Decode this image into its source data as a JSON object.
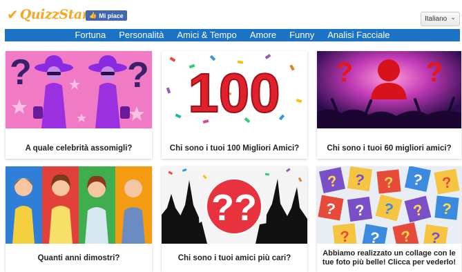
{
  "header": {
    "logo_text": "QuizzStar",
    "like_label": "Mi piace",
    "language": "Italiano"
  },
  "nav": {
    "items": [
      "Fortuna",
      "Personalità",
      "Amici & Tempo",
      "Amore",
      "Funny",
      "Analisi Facciale"
    ]
  },
  "cards": [
    {
      "title": "A quale celebrità assomigli?"
    },
    {
      "title": "Chi sono i tuoi 100 Migliori Amici?",
      "image_text": "100"
    },
    {
      "title": "Chi sono i tuoi 60 migliori amici?"
    },
    {
      "title": "Quanti anni dimostri?"
    },
    {
      "title": "Chi sono i tuoi amici più cari?",
      "image_text": "??"
    },
    {
      "title": "Abbiamo realizzato un collage con le tue foto più belle! Clicca per vederlo!",
      "image_text": "?"
    }
  ],
  "colors": {
    "brand_orange": "#f5a623",
    "nav_blue": "#1a73c4",
    "facebook_blue": "#4267b2"
  }
}
